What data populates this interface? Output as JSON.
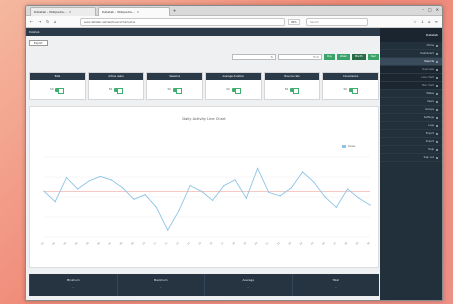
{
  "browser": {
    "tabs": [
      {
        "label": "Datatab - Wikipedia...",
        "active": false
      },
      {
        "label": "Datatab - Wikipedia...",
        "active": true
      }
    ],
    "url": "www.datatab.net/dashboard/charts/line",
    "zoom": "90%",
    "search_placeholder": "Search"
  },
  "app": {
    "topbar_text": "Datatab",
    "export_label": "Export",
    "filters": {
      "buttons": [
        "Day",
        "Week",
        "Month",
        "Year"
      ],
      "from_placeholder": "From",
      "to_placeholder": "To"
    },
    "cards": [
      {
        "title": "Total",
        "value": "50"
      },
      {
        "title": "Active users",
        "value": "50"
      },
      {
        "title": "Sessions",
        "value": "50"
      },
      {
        "title": "Average duration",
        "value": "50"
      },
      {
        "title": "Bounce rate",
        "value": "50"
      },
      {
        "title": "Conversions",
        "value": "50"
      }
    ],
    "chart_title": "Daily Activity Line Chart",
    "chart_sub": "",
    "sidebar": {
      "logo": "Datatab",
      "items": [
        {
          "label": "Home",
          "type": "main"
        },
        {
          "label": "Dashboard",
          "type": "main"
        },
        {
          "label": "Reports",
          "type": "active"
        },
        {
          "label": "Overview",
          "type": "sub"
        },
        {
          "label": "Line chart",
          "type": "sub"
        },
        {
          "label": "Bar chart",
          "type": "sub"
        },
        {
          "label": "Tables",
          "type": "main"
        },
        {
          "label": "Users",
          "type": "main"
        },
        {
          "label": "Groups",
          "type": "main"
        },
        {
          "label": "Settings",
          "type": "main"
        },
        {
          "label": "Logs",
          "type": "main"
        },
        {
          "label": "Export",
          "type": "main"
        },
        {
          "label": "Import",
          "type": "main"
        },
        {
          "label": "Help",
          "type": "main"
        },
        {
          "label": "Sign out",
          "type": "main"
        }
      ]
    },
    "stats": [
      {
        "label": "Minimum",
        "value": "--"
      },
      {
        "label": "Maximum",
        "value": "--"
      },
      {
        "label": "Average",
        "value": "--"
      },
      {
        "label": "Total",
        "value": "--"
      }
    ]
  },
  "chart_data": {
    "type": "line",
    "title": "",
    "legend": [
      "Series"
    ],
    "categories": [
      "01",
      "02",
      "03",
      "04",
      "05",
      "06",
      "07",
      "08",
      "09",
      "10",
      "11",
      "12",
      "13",
      "14",
      "15",
      "16",
      "17",
      "18",
      "19",
      "20",
      "21",
      "22",
      "23",
      "24",
      "25",
      "26",
      "27",
      "28",
      "29",
      "30"
    ],
    "values": [
      40,
      31,
      52,
      42,
      49,
      53,
      50,
      43,
      33,
      37,
      26,
      6,
      23,
      45,
      40,
      32,
      45,
      50,
      34,
      60,
      39,
      36,
      43,
      57,
      48,
      35,
      26,
      42,
      34,
      28
    ],
    "reference_line": 40,
    "ylim": [
      0,
      70
    ],
    "colors": {
      "line": "#8cc4e6",
      "reference": "#f0a8a0"
    }
  }
}
